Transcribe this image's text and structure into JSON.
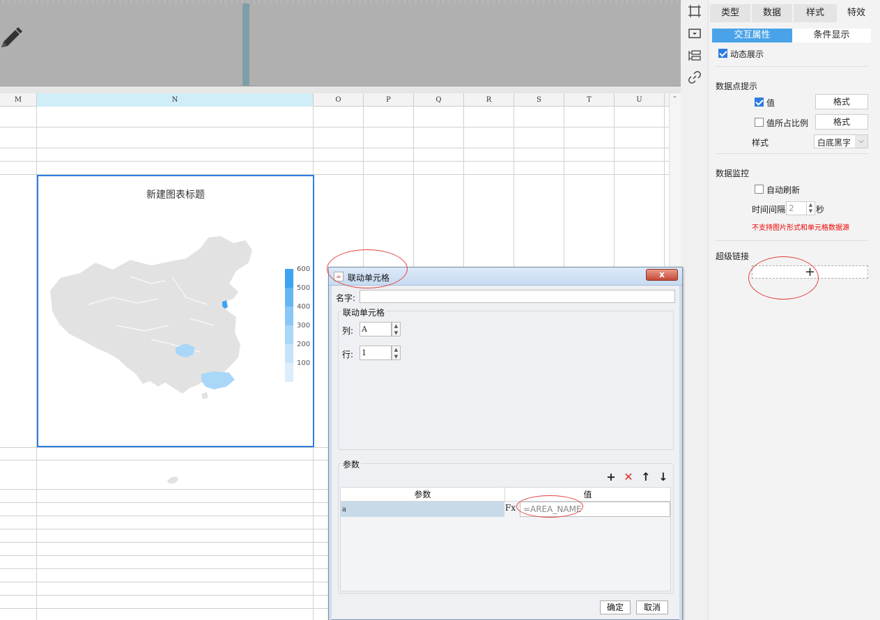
{
  "sheet": {
    "columns": [
      "M",
      "N",
      "O",
      "P",
      "Q",
      "R",
      "S",
      "T",
      "U"
    ],
    "selected_column": "N"
  },
  "chart": {
    "title": "新建图表标题",
    "legend": [
      "600",
      "500",
      "400",
      "300",
      "200",
      "100"
    ],
    "legend_colors": [
      "#3ea3f0",
      "#64b6f3",
      "#88c7f6",
      "#a9d7f8",
      "#c5e3fa",
      "#dcedfc"
    ],
    "map_base_color": "#e2e2e2",
    "highlight_colors": {
      "beijing": "#3ea3f0",
      "chongqing": "#a9d7f8",
      "guangdong": "#a9d7f8"
    }
  },
  "panel": {
    "tabs": [
      "类型",
      "数据",
      "样式",
      "特效"
    ],
    "active_tab": "特效",
    "subtabs": [
      "交互属性",
      "条件显示"
    ],
    "dynamic_display_label": "动态展示",
    "datapoint_hint_title": "数据点提示",
    "value_label": "值",
    "format_label": "格式",
    "value_ratio_label": "值所占比例",
    "format_label_2": "格式",
    "style_label": "样式",
    "style_value": "白底黑字",
    "monitor_title": "数据监控",
    "auto_refresh_label": "自动刷新",
    "interval_label": "时间间隔",
    "interval_value": "2",
    "interval_unit": "秒",
    "warning": "不支持图片形式和单元格数据源",
    "hyperlink_title": "超级链接",
    "add_symbol": "+"
  },
  "dialog": {
    "title": "联动单元格",
    "close_symbol": "x",
    "name_label": "名字:",
    "name_value": "",
    "group_title": "联动单元格",
    "col_label": "列:",
    "col_value": "A",
    "row_label": "行:",
    "row_value": "1",
    "params_title": "参数",
    "param_col_header": "参数",
    "value_col_header": "值",
    "param_row_name": "a",
    "param_row_fx": "Fx",
    "param_row_value": "=AREA_NAME",
    "ok_label": "确定",
    "cancel_label": "取消"
  }
}
